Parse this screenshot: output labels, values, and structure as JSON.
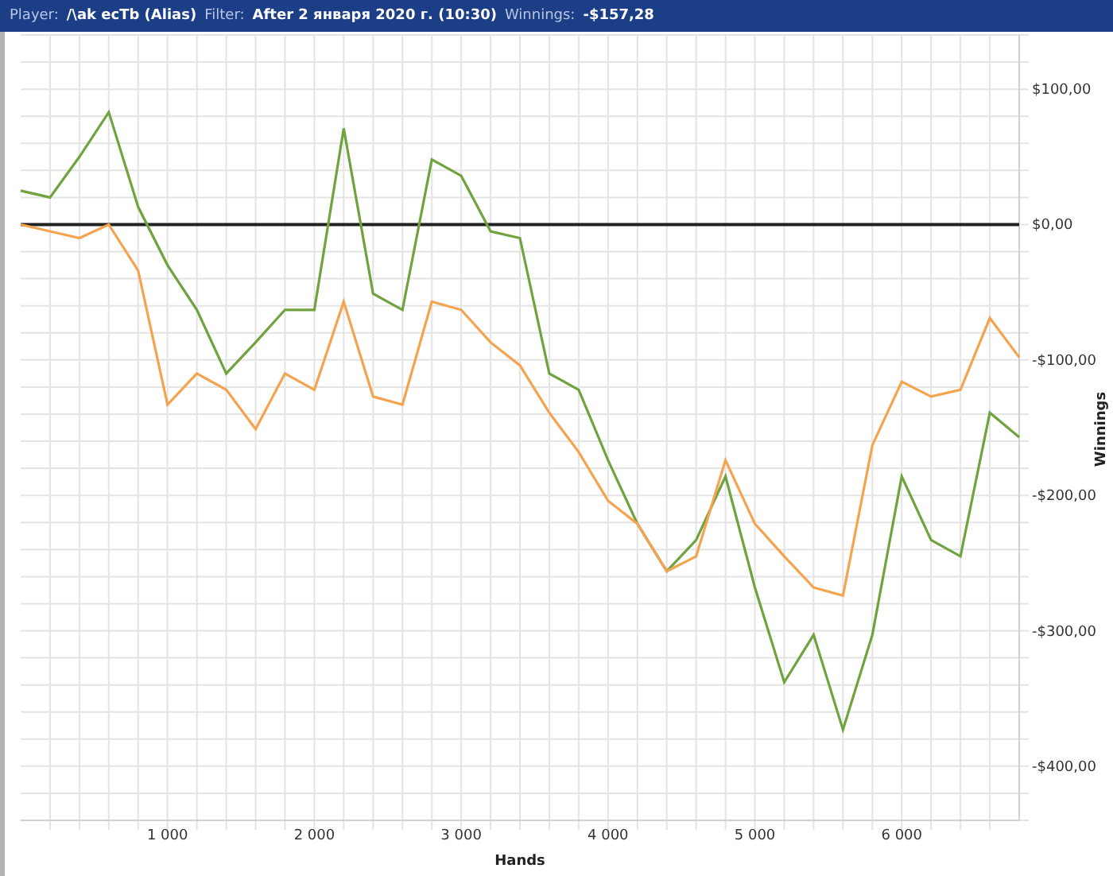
{
  "header": {
    "fields": [
      {
        "label": "Player:",
        "value": "/\\ak ecTb (Alias)"
      },
      {
        "label": "Filter:",
        "value": "After 2 января 2020 г. (10:30)"
      },
      {
        "label": "Winnings:",
        "value": "-$157,28"
      }
    ]
  },
  "chart": {
    "chart_data": {
      "type": "line",
      "xlabel": "Hands",
      "ylabel": "Winnings",
      "x": [
        0,
        200,
        400,
        600,
        800,
        1000,
        1200,
        1400,
        1600,
        1800,
        2000,
        2200,
        2400,
        2600,
        2800,
        3000,
        3200,
        3400,
        3600,
        3800,
        4000,
        4200,
        4400,
        4600,
        4800,
        5000,
        5200,
        5400,
        5600,
        5800,
        6000,
        6200,
        6400,
        6600,
        6800
      ],
      "series": [
        {
          "color": "#70a33f",
          "values": [
            25,
            20,
            50,
            83,
            13,
            -30,
            -63,
            -110,
            -87,
            -63,
            -63,
            71,
            -51,
            -63,
            48,
            36,
            -5,
            -10,
            -110,
            -122,
            -174,
            -221,
            -256,
            -233,
            -186,
            -268,
            -338,
            -303,
            -373,
            -303,
            -186,
            -233,
            -245,
            -139,
            -157
          ]
        },
        {
          "color": "#f4a34f",
          "values": [
            0,
            -5,
            -10,
            0,
            -34,
            -133,
            -110,
            -122,
            -151,
            -110,
            -122,
            -57,
            -127,
            -133,
            -57,
            -63,
            -87,
            -104,
            -139,
            -168,
            -204,
            -221,
            -256,
            -245,
            -174,
            -221,
            -245,
            -268,
            -274,
            -163,
            -116,
            -127,
            -122,
            -69,
            -98
          ]
        }
      ],
      "xlim": [
        0,
        6800
      ],
      "ylim": [
        -440,
        140
      ],
      "xticks": [
        {
          "value": 1000,
          "label": "1 000"
        },
        {
          "value": 2000,
          "label": "2 000"
        },
        {
          "value": 3000,
          "label": "3 000"
        },
        {
          "value": 4000,
          "label": "4 000"
        },
        {
          "value": 5000,
          "label": "5 000"
        },
        {
          "value": 6000,
          "label": "6 000"
        }
      ],
      "yticks": [
        {
          "value": 100,
          "label": "$100,00"
        },
        {
          "value": 0,
          "label": "$0,00"
        },
        {
          "value": -100,
          "label": "-$100,00"
        },
        {
          "value": -200,
          "label": "-$200,00"
        },
        {
          "value": -300,
          "label": "-$300,00"
        },
        {
          "value": -400,
          "label": "-$400,00"
        }
      ],
      "grid": true,
      "ref_lines": [
        {
          "axis": "y",
          "value": 0
        }
      ]
    }
  }
}
